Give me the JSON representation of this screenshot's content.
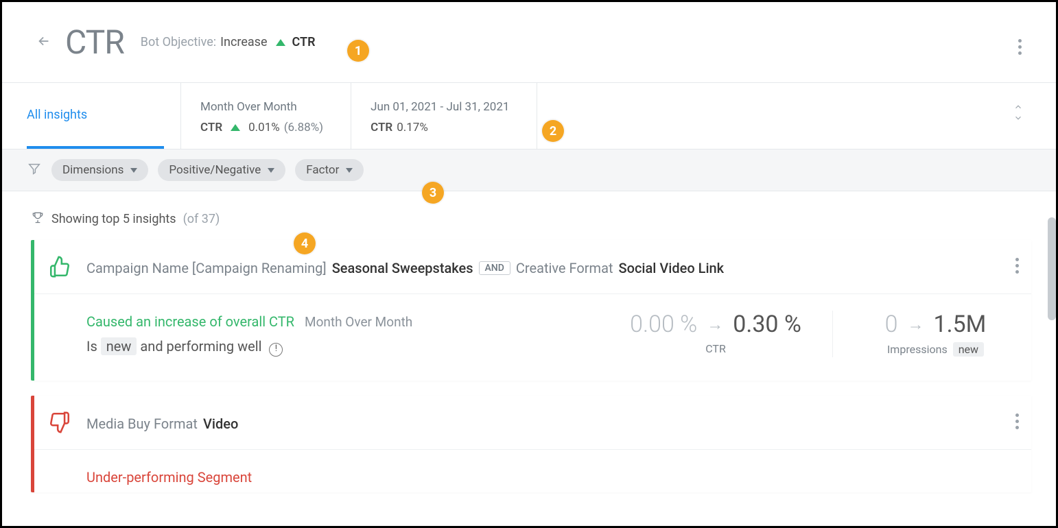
{
  "header": {
    "title": "CTR",
    "objective_label": "Bot Objective:",
    "objective_value": "Increase",
    "metric": "CTR"
  },
  "callouts": {
    "b1": "1",
    "b2": "2",
    "b3": "3",
    "b4": "4"
  },
  "tabs": {
    "all_insights": "All insights"
  },
  "stats": {
    "mom": {
      "title": "Month Over Month",
      "metric": "CTR",
      "change": "0.01%",
      "pct": "(6.88%)"
    },
    "range": {
      "title": "Jun 01, 2021 - Jul 31, 2021",
      "metric": "CTR",
      "value": "0.17%"
    }
  },
  "filters": {
    "dimensions": "Dimensions",
    "posneg": "Positive/Negative",
    "factor": "Factor"
  },
  "insight_count": {
    "prefix": "Showing top 5 insights",
    "suffix": "(of 37)"
  },
  "cards": [
    {
      "sentiment": "positive",
      "title_parts": {
        "dim1_label": "Campaign Name [Campaign Renaming]",
        "dim1_value": "Seasonal Sweepstakes",
        "join": "AND",
        "dim2_label": "Creative Format",
        "dim2_value": "Social Video Link"
      },
      "desc": {
        "cause": "Caused an increase of overall CTR",
        "period": "Month Over Month",
        "line2_pre": "Is",
        "line2_tag": "new",
        "line2_post": "and performing well"
      },
      "metric1": {
        "from": "0.00 %",
        "to": "0.30 %",
        "label": "CTR"
      },
      "metric2": {
        "from": "0",
        "to": "1.5M",
        "label": "Impressions",
        "tag": "new"
      }
    },
    {
      "sentiment": "negative",
      "title_parts": {
        "dim1_label": "Media Buy Format",
        "dim1_value": "Video"
      },
      "desc": {
        "cause": "Under-performing Segment"
      }
    }
  ]
}
